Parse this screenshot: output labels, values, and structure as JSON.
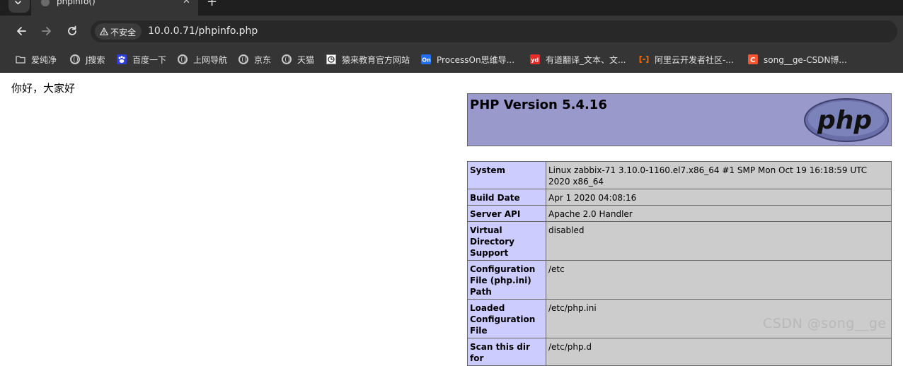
{
  "browser": {
    "tab_title": "phpinfo()",
    "tab_close": "✕",
    "new_tab": "+",
    "stray_glyph": "J",
    "security_label": "不安全",
    "url": "10.0.0.71/phpinfo.php"
  },
  "bookmarks": [
    {
      "label": "爱纯净",
      "icon": "folder-icon"
    },
    {
      "label": "J搜索",
      "icon": "globe-icon"
    },
    {
      "label": "百度一下",
      "icon": "baidu-icon"
    },
    {
      "label": "上网导航",
      "icon": "globe-icon"
    },
    {
      "label": "京东",
      "icon": "globe-icon"
    },
    {
      "label": "天猫",
      "icon": "globe-icon"
    },
    {
      "label": "猿来教育官方网站",
      "icon": "site-icon"
    },
    {
      "label": "ProcessOn思维导...",
      "icon": "processon-icon"
    },
    {
      "label": "有道翻译_文本、文...",
      "icon": "youdao-icon"
    },
    {
      "label": "阿里云开发者社区-...",
      "icon": "aliyun-icon"
    },
    {
      "label": "song__ge-CSDN博...",
      "icon": "csdn-icon"
    }
  ],
  "page": {
    "greeting": "你好，大家好",
    "php_version": "PHP Version 5.4.16",
    "php_logo_text": "php",
    "rows": [
      {
        "key": "System",
        "value": "Linux zabbix-71 3.10.0-1160.el7.x86_64 #1 SMP Mon Oct 19 16:18:59 UTC 2020 x86_64"
      },
      {
        "key": "Build Date",
        "value": "Apr 1 2020 04:08:16"
      },
      {
        "key": "Server API",
        "value": "Apache 2.0 Handler"
      },
      {
        "key": "Virtual Directory Support",
        "value": "disabled"
      },
      {
        "key": "Configuration File (php.ini) Path",
        "value": "/etc"
      },
      {
        "key": "Loaded Configuration File",
        "value": "/etc/php.ini"
      },
      {
        "key": "Scan this dir for",
        "value": "/etc/php.d"
      }
    ]
  },
  "watermark": "CSDN @song__ge",
  "colors": {
    "php_header_bg": "#9999cc",
    "table_key_bg": "#ccccff",
    "table_value_bg": "#cccccc",
    "chrome_dark": "#353535"
  }
}
